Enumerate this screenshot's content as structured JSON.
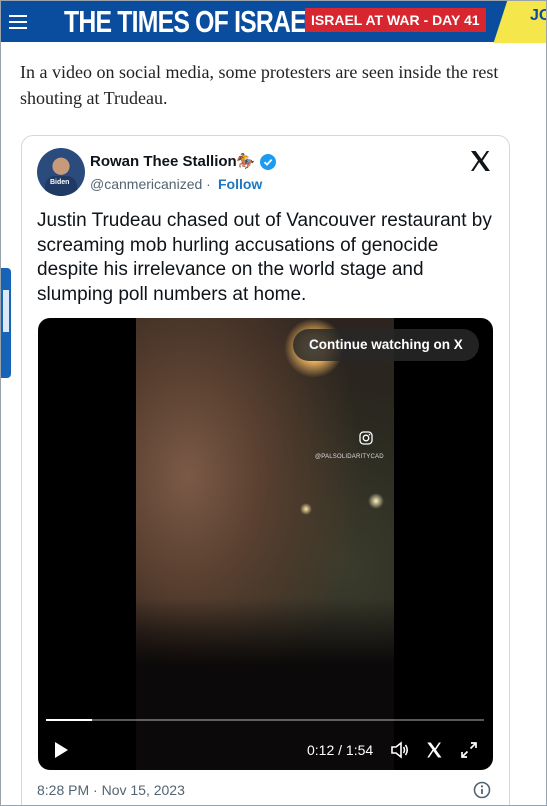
{
  "header": {
    "logo": "THE TIMES OF ISRAEL",
    "war_badge": "ISRAEL AT WAR - DAY 41",
    "join_label": "JO",
    "brand_color": "#0a4d9e",
    "badge_color": "#d7262f"
  },
  "article": {
    "lead_line1": "In a video on social media, some protesters are seen inside the rest",
    "lead_line2": "shouting at Trudeau."
  },
  "tweet": {
    "author_name": "Rowan Thee Stallion",
    "author_emoji": "🏇",
    "handle": "@canmericanized",
    "separator": "·",
    "follow_label": "Follow",
    "text": "Justin Trudeau chased out of Vancouver restaurant by screaming mob hurling accusations of genocide despite his irrelevance on the world stage and slumping poll numbers at home.",
    "video": {
      "continue_label": "Continue watching on X",
      "watermark": "@PALSOLIDARITYCAD",
      "time_display": "0:12 / 1:54",
      "progress_fraction": 0.105
    },
    "timestamp": "8:28 PM · Nov 15, 2023",
    "avatar_text": "Biden"
  },
  "icons": [
    "menu-icon",
    "verified-badge-icon",
    "x-logo-icon",
    "instagram-icon",
    "play-icon",
    "volume-icon",
    "x-icon",
    "fullscreen-icon",
    "info-icon"
  ]
}
